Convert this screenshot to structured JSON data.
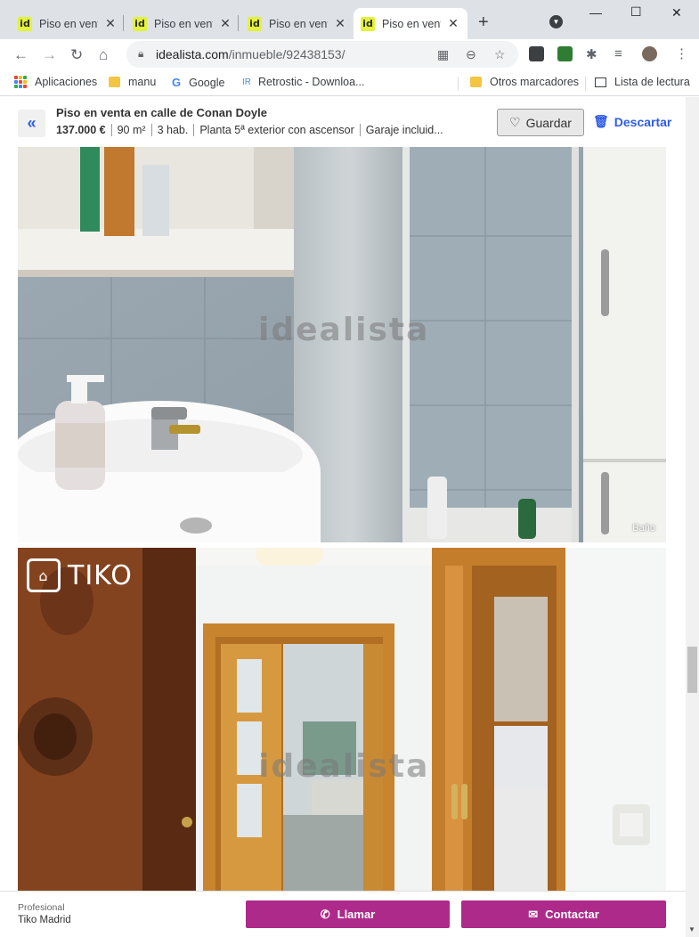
{
  "browser": {
    "tabs": [
      {
        "label": "Piso en venta en calle de Conan Doyle",
        "active": false
      },
      {
        "label": "Piso en venta en calle de Conan Doyle",
        "active": false
      },
      {
        "label": "Piso en venta en calle de Conan Doyle",
        "active": false
      },
      {
        "label": "Piso en venta en calle de Conan Doyle",
        "active": true
      }
    ],
    "favicon_text": "id",
    "url_domain": "idealista.com",
    "url_path": "/inmueble/92438153/",
    "bookmarks": [
      {
        "label": "Aplicaciones",
        "icon": "apps-grid-icon"
      },
      {
        "label": "manu",
        "icon": "folder-icon"
      },
      {
        "label": "Google",
        "icon": "google-icon"
      },
      {
        "label": "Retrostic - Downloa...",
        "icon": "retrostic-icon"
      }
    ],
    "other_bookmarks": "Otros marcadores",
    "reading_list": "Lista de lectura"
  },
  "listing": {
    "title": "Piso en venta en calle de Conan Doyle",
    "price": "137.000 €",
    "features": [
      "90 m²",
      "3 hab.",
      "Planta 5ª exterior con ascensor",
      "Garaje incluid..."
    ],
    "save_label": "Guardar",
    "discard_label": "Descartar",
    "back_icon": "double-chevron-left-icon"
  },
  "gallery": {
    "watermark": "idealista",
    "photos": [
      {
        "caption": "Baño",
        "brand": ""
      },
      {
        "caption": "",
        "brand": "TIKO"
      }
    ]
  },
  "contact_bar": {
    "agent_type": "Profesional",
    "agent_name": "Tiko Madrid",
    "call_label": "Llamar",
    "contact_label": "Contactar"
  },
  "colors": {
    "accent_blue": "#2e5ce6",
    "cta_magenta": "#ad2a8a",
    "favicon_yellow": "#e3f23d"
  }
}
